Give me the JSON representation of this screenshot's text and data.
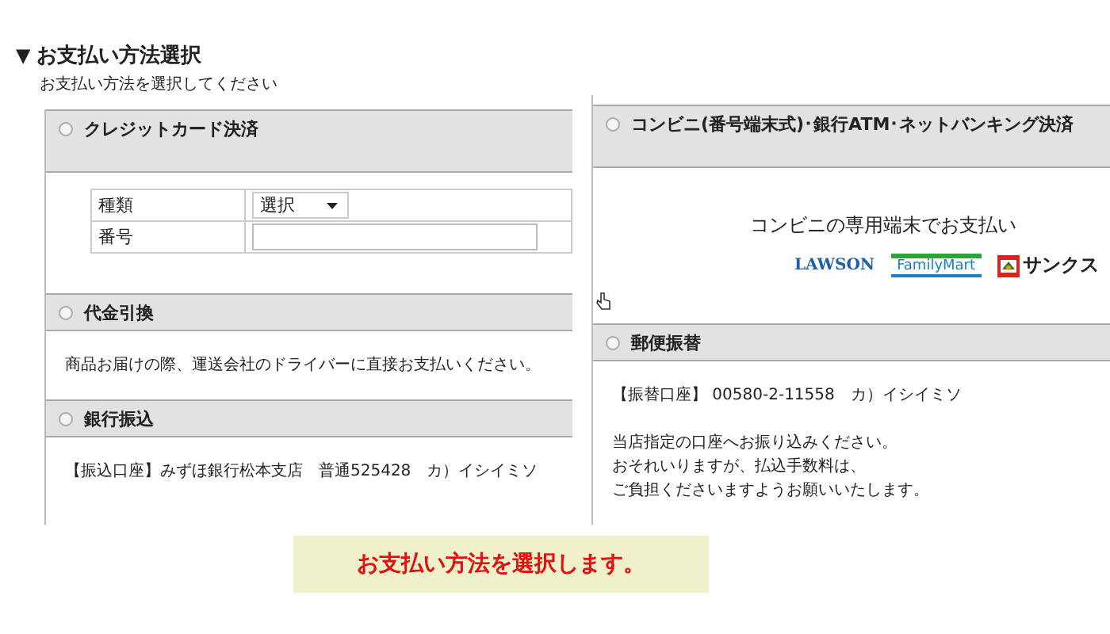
{
  "section": {
    "marker": "▼",
    "title": "お支払い方法選択",
    "subtitle": "お支払い方法を選択してください"
  },
  "left_methods": [
    {
      "kind": "card",
      "label": "クレジットカード決済",
      "selected": false,
      "fields": [
        {
          "label": "種類",
          "kind": "select",
          "value": "選択"
        },
        {
          "label": "番号",
          "kind": "input"
        }
      ]
    },
    {
      "kind": "text",
      "label": "代金引換",
      "selected": false,
      "paragraphs": [
        [
          "商品お届けの際、運送会社のドライバーに直接お支払いください。"
        ]
      ]
    },
    {
      "kind": "text",
      "label": "銀行振込",
      "selected": false,
      "paragraphs": [
        [
          "【振込口座】みずほ銀行松本支店　普通525428　カ）イシイミソ"
        ]
      ]
    }
  ],
  "right_methods": [
    {
      "kind": "stores",
      "label": "コンビニ(番号端末式)･銀行ATM･ネットバンキング決済",
      "selected": false,
      "heading": "コンビニの専用端末でお支払い",
      "logos": [
        {
          "kind": "lawson",
          "text": "LAWSON"
        },
        {
          "kind": "familymart",
          "text": "FamilyMart"
        },
        {
          "kind": "sunkus",
          "text": "サンクス"
        }
      ]
    },
    {
      "kind": "text",
      "label": "郵便振替",
      "selected": false,
      "paragraphs": [
        [
          "【振替口座】 00580-2-11558　カ）イシイミソ"
        ],
        [
          "当店指定の口座へお振り込みください。",
          "おそれいりますが、払込手数料は、",
          "ご負担くださいますようお願いいたします。"
        ]
      ]
    }
  ],
  "caption": "お支払い方法を選択します。"
}
